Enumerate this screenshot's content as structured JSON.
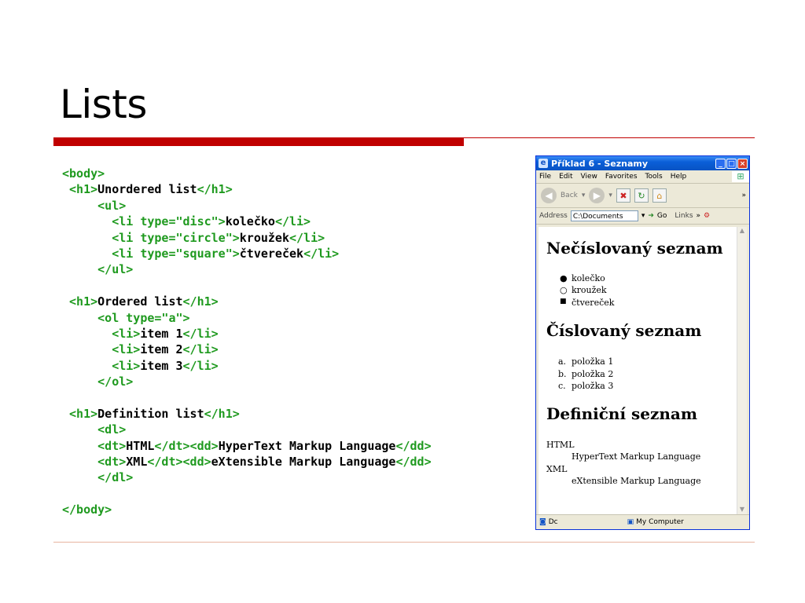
{
  "slide": {
    "title": "Lists"
  },
  "code_lines": [
    [
      [
        "t",
        "<body>"
      ]
    ],
    [
      [
        "p",
        " "
      ],
      [
        "t",
        "<h1>"
      ],
      [
        "p",
        "Unordered list"
      ],
      [
        "t",
        "</h1>"
      ]
    ],
    [
      [
        "p",
        "     "
      ],
      [
        "t",
        "<ul>"
      ]
    ],
    [
      [
        "p",
        "       "
      ],
      [
        "t",
        "<li type=\"disc\">"
      ],
      [
        "p",
        "kolečko"
      ],
      [
        "t",
        "</li>"
      ]
    ],
    [
      [
        "p",
        "       "
      ],
      [
        "t",
        "<li type=\"circle\">"
      ],
      [
        "p",
        "kroužek"
      ],
      [
        "t",
        "</li>"
      ]
    ],
    [
      [
        "p",
        "       "
      ],
      [
        "t",
        "<li type=\"square\">"
      ],
      [
        "p",
        "čtvereček"
      ],
      [
        "t",
        "</li>"
      ]
    ],
    [
      [
        "p",
        "     "
      ],
      [
        "t",
        "</ul>"
      ]
    ],
    [],
    [
      [
        "p",
        " "
      ],
      [
        "t",
        "<h1>"
      ],
      [
        "p",
        "Ordered list"
      ],
      [
        "t",
        "</h1>"
      ]
    ],
    [
      [
        "p",
        "     "
      ],
      [
        "t",
        "<ol type=\"a\">"
      ]
    ],
    [
      [
        "p",
        "       "
      ],
      [
        "t",
        "<li>"
      ],
      [
        "p",
        "item 1"
      ],
      [
        "t",
        "</li>"
      ]
    ],
    [
      [
        "p",
        "       "
      ],
      [
        "t",
        "<li>"
      ],
      [
        "p",
        "item 2"
      ],
      [
        "t",
        "</li>"
      ]
    ],
    [
      [
        "p",
        "       "
      ],
      [
        "t",
        "<li>"
      ],
      [
        "p",
        "item 3"
      ],
      [
        "t",
        "</li>"
      ]
    ],
    [
      [
        "p",
        "     "
      ],
      [
        "t",
        "</ol>"
      ]
    ],
    [],
    [
      [
        "p",
        " "
      ],
      [
        "t",
        "<h1>"
      ],
      [
        "p",
        "Definition list"
      ],
      [
        "t",
        "</h1>"
      ]
    ],
    [
      [
        "p",
        "     "
      ],
      [
        "t",
        "<dl>"
      ]
    ],
    [
      [
        "p",
        "     "
      ],
      [
        "t",
        "<dt>"
      ],
      [
        "p",
        "HTML"
      ],
      [
        "t",
        "</dt><dd>"
      ],
      [
        "p",
        "HyperText Markup Language"
      ],
      [
        "t",
        "</dd>"
      ]
    ],
    [
      [
        "p",
        "     "
      ],
      [
        "t",
        "<dt>"
      ],
      [
        "p",
        "XML"
      ],
      [
        "t",
        "</dt><dd>"
      ],
      [
        "p",
        "eXtensible Markup Language"
      ],
      [
        "t",
        "</dd>"
      ]
    ],
    [
      [
        "p",
        "     "
      ],
      [
        "t",
        "</dl>"
      ]
    ],
    [],
    [
      [
        "t",
        "</body>"
      ]
    ]
  ],
  "browser": {
    "title": "Příklad 6 - Seznamy",
    "menu": [
      "File",
      "Edit",
      "View",
      "Favorites",
      "Tools",
      "Help"
    ],
    "toolbar": {
      "back": "Back"
    },
    "address": {
      "label": "Address",
      "value": "C:\\Documents",
      "go": "Go",
      "links": "Links"
    },
    "content": {
      "h1_unordered": "Nečíslovaný seznam",
      "ul_items": [
        "kolečko",
        "kroužek",
        "čtvereček"
      ],
      "h1_ordered": "Číslovaný seznam",
      "ol_markers": [
        "a.",
        "b.",
        "c."
      ],
      "ol_items": [
        "položka 1",
        "položka 2",
        "položka 3"
      ],
      "h1_definition": "Definiční seznam",
      "dl": [
        {
          "dt": "HTML",
          "dd": "HyperText Markup Language"
        },
        {
          "dt": "XML",
          "dd": "eXtensible Markup Language"
        }
      ]
    },
    "status": {
      "left": "Dc",
      "zone": "My Computer"
    }
  }
}
